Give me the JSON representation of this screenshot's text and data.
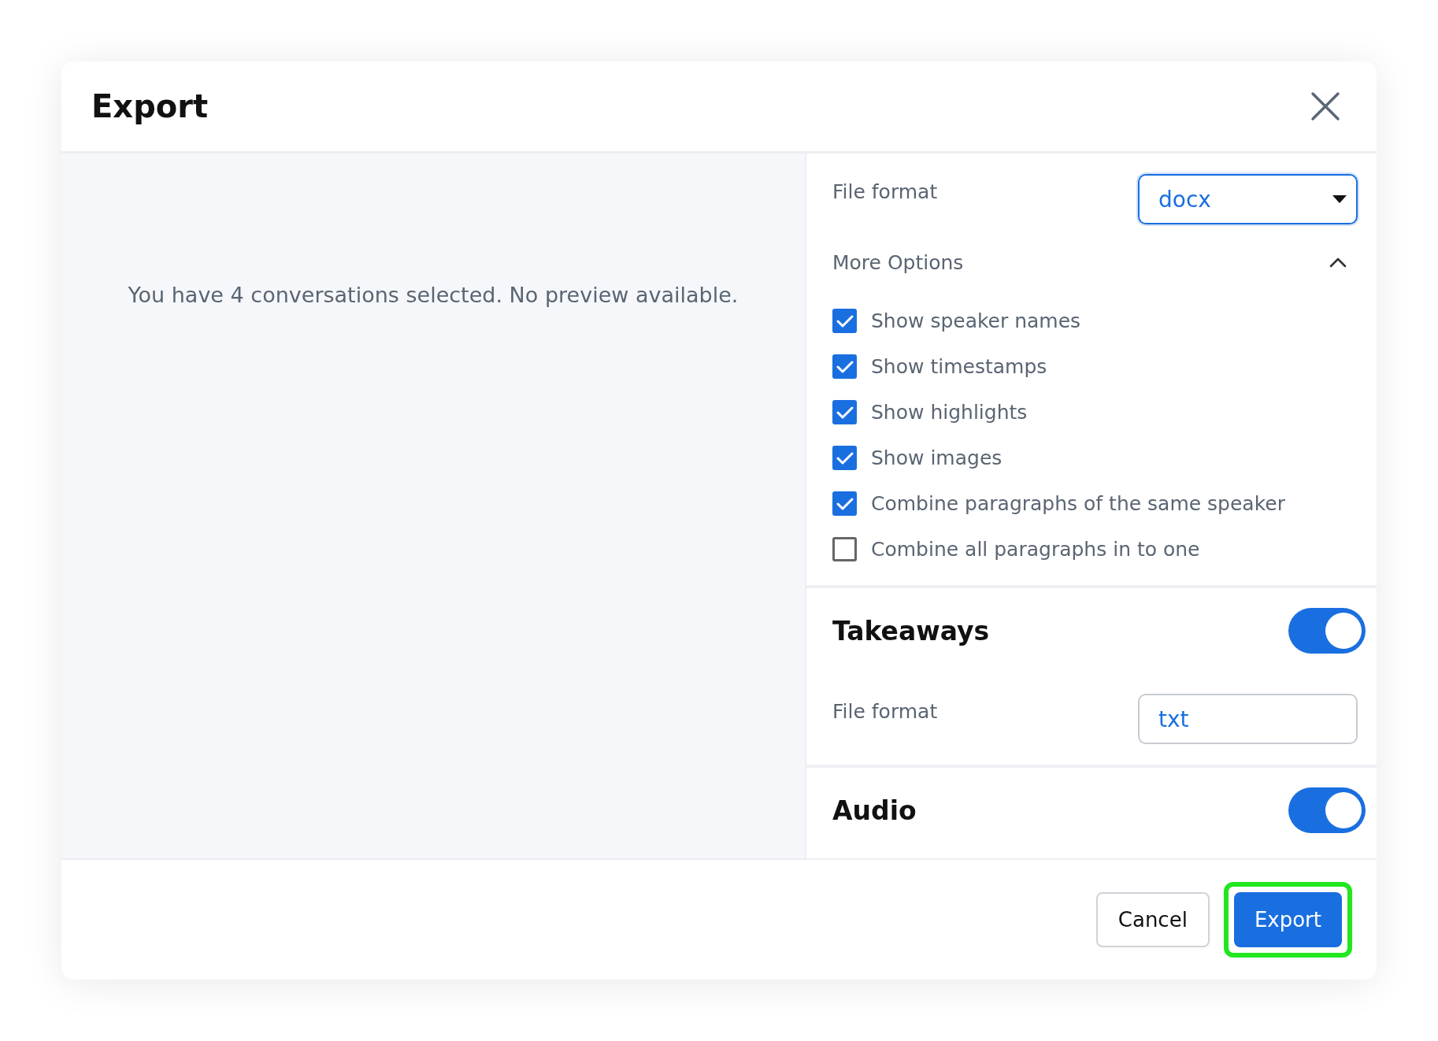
{
  "dialog": {
    "title": "Export"
  },
  "preview": {
    "message": "You have 4 conversations selected. No preview available."
  },
  "transcript": {
    "format_label": "File format",
    "format": {
      "value": "docx",
      "focused": true
    },
    "more_options": {
      "label": "More Options",
      "expanded": true
    },
    "options": [
      {
        "label": "Show speaker names",
        "checked": true
      },
      {
        "label": "Show timestamps",
        "checked": true
      },
      {
        "label": "Show highlights",
        "checked": true
      },
      {
        "label": "Show images",
        "checked": true
      },
      {
        "label": "Combine paragraphs of the same speaker",
        "checked": true
      },
      {
        "label": "Combine all paragraphs in to one",
        "checked": false
      }
    ]
  },
  "sections": [
    {
      "title": "Takeaways",
      "on": true,
      "format_label": "File format",
      "format": {
        "value": "txt",
        "focused": false
      }
    },
    {
      "title": "Audio",
      "on": true
    }
  ],
  "buttons": [
    {
      "label": "Cancel",
      "kind": "secondary",
      "focused": false
    },
    {
      "label": "Export",
      "kind": "primary",
      "focused": true
    }
  ]
}
